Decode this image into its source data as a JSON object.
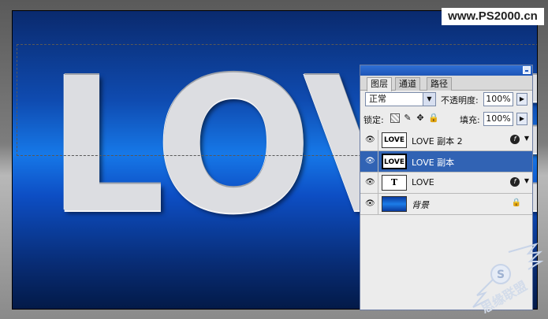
{
  "watermark": "www.PS2000.cn",
  "canvas": {
    "text": "LOVE"
  },
  "panel": {
    "tabs": [
      {
        "label": "图层",
        "active": true
      },
      {
        "label": "通道",
        "active": false
      },
      {
        "label": "路径",
        "active": false
      }
    ],
    "blend_mode": "正常",
    "opacity_label": "不透明度:",
    "opacity_value": "100%",
    "lock_label": "锁定:",
    "lock_icons": [
      "lock-transparent-icon",
      "lock-image-icon",
      "lock-position-icon",
      "lock-all-icon"
    ],
    "fill_label": "填充:",
    "fill_value": "100%",
    "layers": [
      {
        "name": "LOVE 副本 2",
        "thumb": "LOVE",
        "visible": true,
        "selected": false,
        "fx": true
      },
      {
        "name": "LOVE 副本",
        "thumb": "LOVE",
        "visible": true,
        "selected": true,
        "fx": false
      },
      {
        "name": "LOVE",
        "thumb": "T",
        "visible": true,
        "selected": false,
        "fx": true
      },
      {
        "name": "背景",
        "thumb": "",
        "visible": true,
        "selected": false,
        "fx": false,
        "locked": true
      }
    ]
  },
  "colors": {
    "selected_layer": "#3163b4",
    "canvas_blue": "#1678e8"
  }
}
